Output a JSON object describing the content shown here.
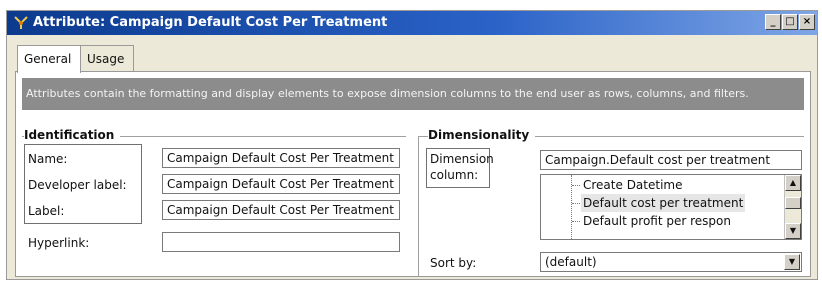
{
  "window": {
    "title": "Attribute: Campaign Default Cost Per Treatment",
    "minimize_label": "_",
    "maximize_label": "□",
    "close_label": "×"
  },
  "tabs": [
    {
      "label": "General",
      "active": true
    },
    {
      "label": "Usage",
      "active": false
    }
  ],
  "description": "Attributes contain the formatting and display elements to expose dimension columns to the end user as rows, columns, and filters.",
  "identification": {
    "title": "Identification",
    "name_label": "Name:",
    "name_value": "Campaign Default Cost Per Treatment",
    "developer_label_label": "Developer label:",
    "developer_label_value": "Campaign Default Cost Per Treatment",
    "label_label": "Label:",
    "label_value": "Campaign Default Cost Per Treatment",
    "hyperlink_label": "Hyperlink:",
    "hyperlink_value": ""
  },
  "dimensionality": {
    "title": "Dimensionality",
    "dimension_column_label_line1": "Dimension",
    "dimension_column_label_line2": "column:",
    "dimension_column_value": "Campaign.Default cost per treatment",
    "tree_items": [
      {
        "label": "Create Datetime",
        "selected": false
      },
      {
        "label": "Default cost per treatment",
        "selected": true
      },
      {
        "label": "Default profit per respon",
        "selected": false
      }
    ],
    "sort_by_label": "Sort by:",
    "sort_by_value": "(default)"
  },
  "icons": {
    "window_icon": "attribute-icon",
    "scroll_up": "arrow-up-icon",
    "scroll_down": "arrow-down-icon",
    "combo": "chevron-down-icon"
  }
}
